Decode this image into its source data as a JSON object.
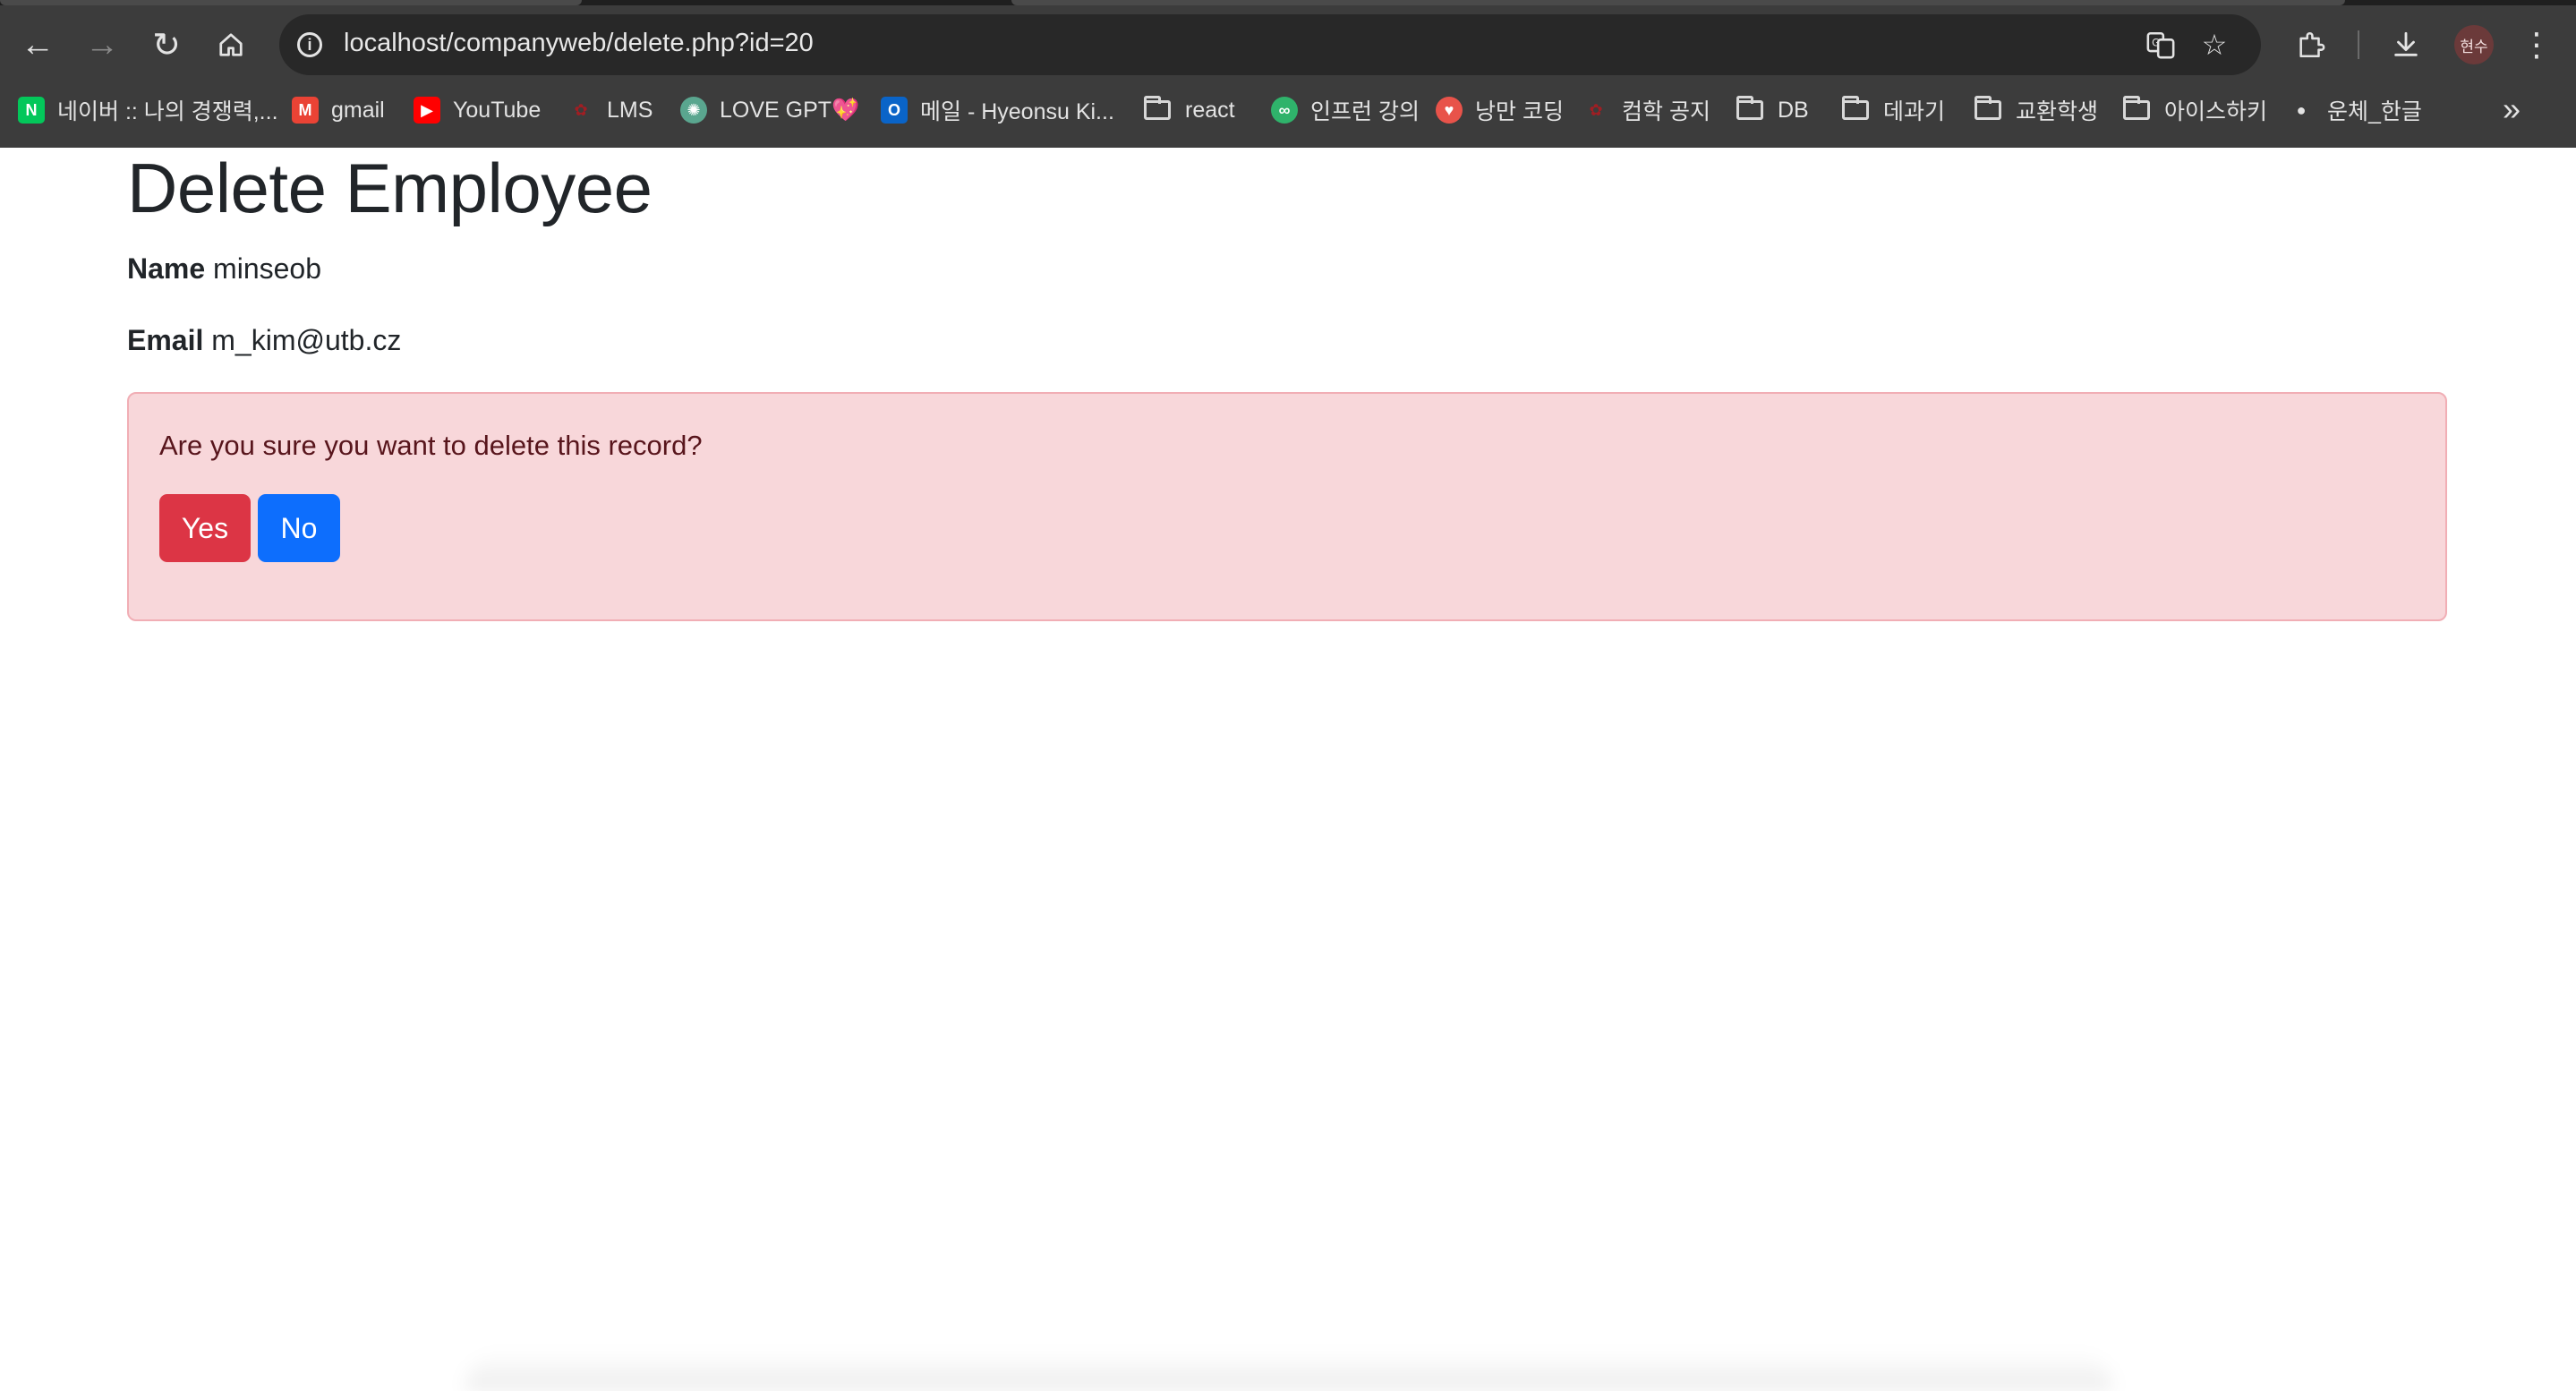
{
  "browser": {
    "url": "localhost/companyweb/delete.php?id=20",
    "profile_label": "현수",
    "bookmarks": [
      {
        "label": "네이버 :: 나의 경쟁력,...",
        "icon": "naver-icon",
        "fav_text": "N",
        "color": "#03c75a"
      },
      {
        "label": "gmail",
        "icon": "gmail-icon",
        "fav_text": "M",
        "color": "#ea4335"
      },
      {
        "label": "YouTube",
        "icon": "youtube-icon",
        "fav_text": "▶",
        "color": "#ff0000"
      },
      {
        "label": "LMS",
        "icon": "lms-icon",
        "fav_text": "✿",
        "color": "#a01e23"
      },
      {
        "label": "LOVE GPT💖",
        "icon": "chatgpt-icon",
        "fav_text": "✺",
        "color": "#5aa68f"
      },
      {
        "label": "메일 - Hyeonsu Ki...",
        "icon": "outlook-icon",
        "fav_text": "O",
        "color": "#0a64c8"
      },
      {
        "label": "react",
        "icon": "folder-icon"
      },
      {
        "label": "인프런 강의",
        "icon": "inflearn-icon",
        "fav_text": "∞",
        "color": "#2fb36b"
      },
      {
        "label": "낭만 코딩",
        "icon": "romantic-coding-icon",
        "fav_text": "♥",
        "color": "#e8534a"
      },
      {
        "label": "컴학 공지",
        "icon": "cs-notice-icon",
        "fav_text": "✿",
        "color": "#a01e23"
      },
      {
        "label": "DB",
        "icon": "folder-icon"
      },
      {
        "label": "데과기",
        "icon": "folder-icon"
      },
      {
        "label": "교환학생",
        "icon": "folder-icon"
      },
      {
        "label": "아이스하키",
        "icon": "folder-icon"
      },
      {
        "label": "운체_한글",
        "icon": "github-icon",
        "fav_text": "●",
        "color": "#e3e3e3"
      }
    ]
  },
  "page": {
    "title": "Delete Employee",
    "name_label": "Name",
    "name_value": "minseob",
    "email_label": "Email",
    "email_value": "m_kim@utb.cz",
    "confirm_text": "Are you sure you want to delete this record?",
    "yes_label": "Yes",
    "no_label": "No"
  },
  "colors": {
    "alert_bg": "#f8d7da",
    "danger": "#dc3545",
    "primary": "#0d6efd"
  }
}
